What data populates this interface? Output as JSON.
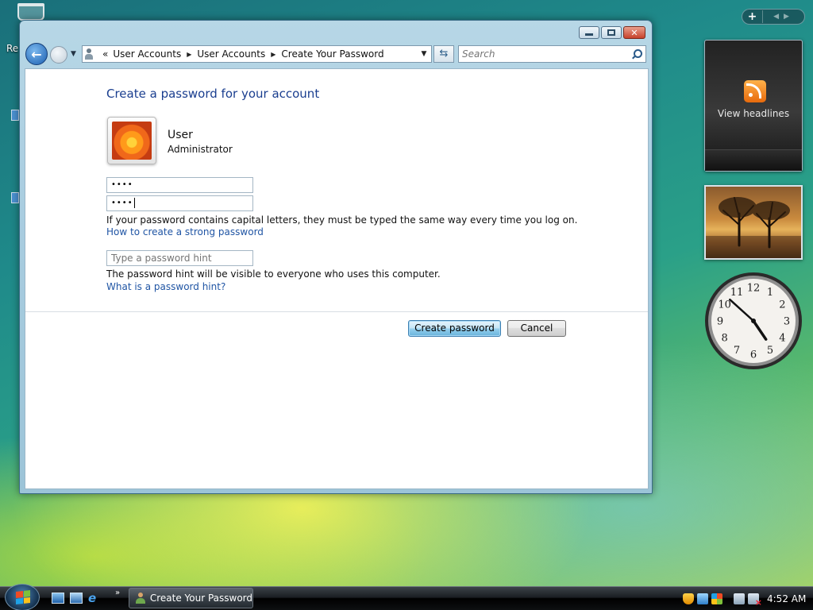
{
  "desktop": {
    "icon_label_fragment": "Re"
  },
  "window": {
    "breadcrumbs": [
      "User Accounts",
      "User Accounts",
      "Create Your Password"
    ],
    "breadcrumb_prefix": "«",
    "search_placeholder": "Search",
    "page_title": "Create a password for your account",
    "user": {
      "name": "User",
      "role": "Administrator"
    },
    "password_value": "••••",
    "confirm_value": "••••",
    "caps_note": "If your password contains capital letters, they must be typed the same way every time you log on.",
    "strong_link": "How to create a strong password",
    "hint_placeholder": "Type a password hint",
    "hint_note": "The password hint will be visible to everyone who uses this computer.",
    "hint_link": "What is a password hint?",
    "create_button": "Create password",
    "cancel_button": "Cancel"
  },
  "sidebar": {
    "feed_label": "View headlines",
    "clock": {
      "numbers": [
        "12",
        "1",
        "2",
        "3",
        "4",
        "5",
        "6",
        "7",
        "8",
        "9",
        "10",
        "11"
      ],
      "hour": 4,
      "minute": 52
    }
  },
  "taskbar": {
    "task_label": "Create Your Password",
    "overflow": "»",
    "time": "4:52 AM"
  },
  "colors": {
    "title_blue": "#1a3e8f",
    "link_blue": "#2055a4",
    "feed_orange": "#e76a0c"
  }
}
